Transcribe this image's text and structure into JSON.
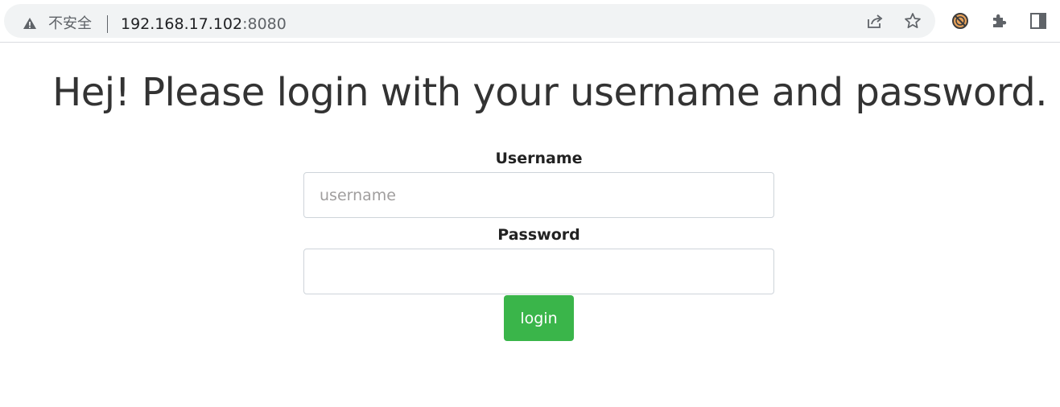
{
  "browser": {
    "security_label": "不安全",
    "url_host": "192.168.17.102",
    "url_port": ":8080",
    "icons": [
      "warning-icon",
      "share-icon",
      "star-icon",
      "extension-blocked-icon",
      "puzzle-icon",
      "side-panel-icon"
    ]
  },
  "page": {
    "title": "Hej! Please login with your username and password."
  },
  "form": {
    "username_label": "Username",
    "username_placeholder": "username",
    "username_value": "",
    "password_label": "Password",
    "password_value": "",
    "login_label": "login"
  },
  "colors": {
    "login_button": "#3ab54a",
    "title_text": "#333333",
    "omnibox_bg": "#f1f3f4"
  }
}
